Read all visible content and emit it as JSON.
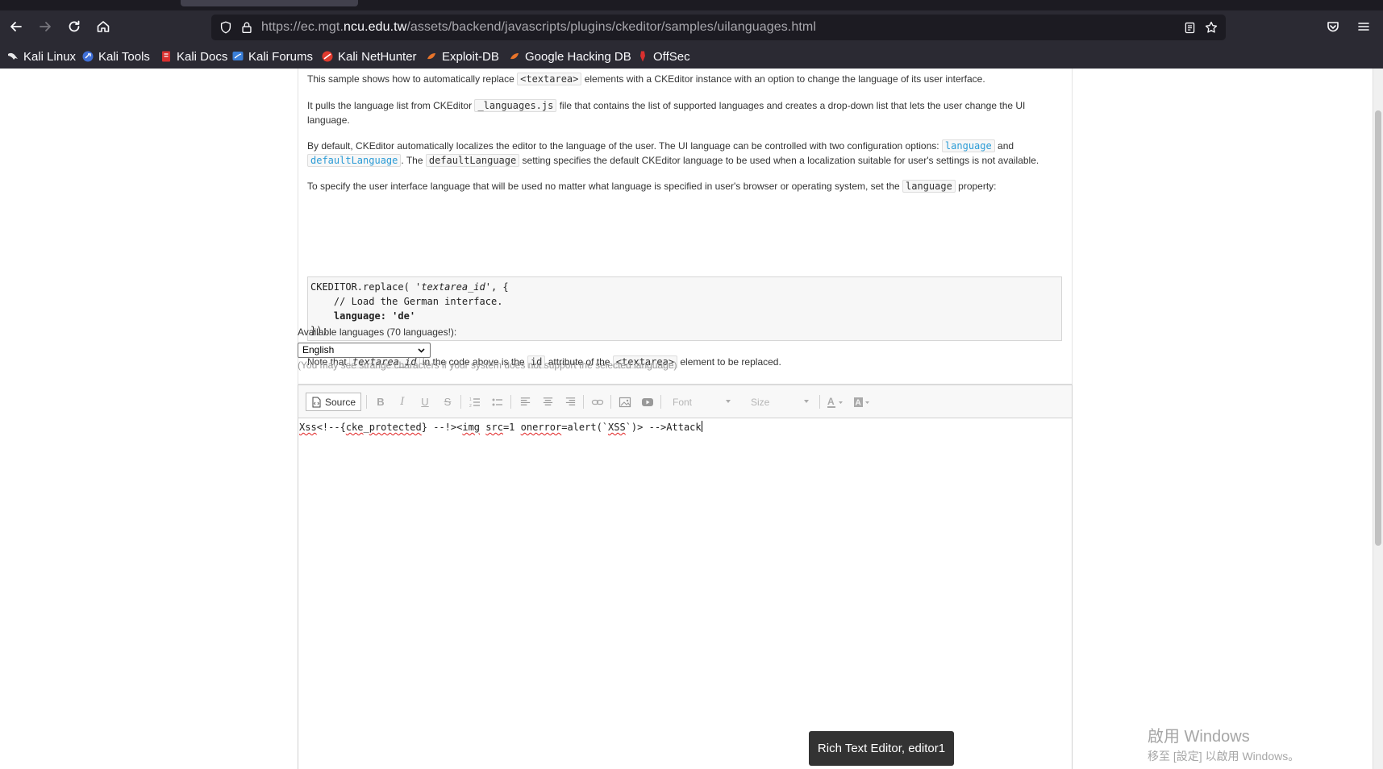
{
  "browser": {
    "url_prefix": "https://ec.mgt.",
    "url_domain": "ncu.edu.tw",
    "url_path": "/assets/backend/javascripts/plugins/ckeditor/samples/uilanguages.html",
    "bookmarks": [
      {
        "label": "Kali Linux",
        "icon": "kali-dragon-icon"
      },
      {
        "label": "Kali Tools",
        "icon": "kali-tools-icon"
      },
      {
        "label": "Kali Docs",
        "icon": "kali-docs-icon"
      },
      {
        "label": "Kali Forums",
        "icon": "kali-forums-icon"
      },
      {
        "label": "Kali NetHunter",
        "icon": "nethunter-icon"
      },
      {
        "label": "Exploit-DB",
        "icon": "exploit-db-icon"
      },
      {
        "label": "Google Hacking DB",
        "icon": "ghdb-icon"
      },
      {
        "label": "OffSec",
        "icon": "offsec-icon"
      }
    ]
  },
  "description": {
    "p1_before": "This sample shows how to automatically replace ",
    "p1_code": "<textarea>",
    "p1_after": " elements with a CKEditor instance with an option to change the language of its user interface.",
    "p2_before": "It pulls the language list from CKEditor ",
    "p2_code": "_languages.js",
    "p2_after": " file that contains the list of supported languages and creates a drop-down list that lets the user change the UI language.",
    "p3_before": "By default, CKEditor automatically localizes the editor to the language of the user. The UI language can be controlled with two configuration options: ",
    "p3_code1": "language",
    "p3_mid": " and ",
    "p3_code2": "defaultLanguage",
    "p3_mid2": ". The ",
    "p3_code3": "defaultLanguage",
    "p3_after": " setting specifies the default CKEditor language to be used when a localization suitable for user's settings is not available.",
    "p4_before": "To specify the user interface language that will be used no matter what language is specified in user's browser or operating system, set the ",
    "p4_code": "language",
    "p4_after": " property:",
    "code_l1a": "CKEDITOR.replace( ",
    "code_l1b": "'textarea_id'",
    "code_l1c": ", {",
    "code_l2": "    // Load the German interface.",
    "code_l3": "    language: 'de'",
    "code_l4": "});",
    "p5_before": "Note that ",
    "p5_code1": "textarea_id",
    "p5_mid": " in the code above is the ",
    "p5_code2": "id",
    "p5_mid2": " attribute of the ",
    "p5_code3": "<textarea>",
    "p5_after": " element to be replaced."
  },
  "languages": {
    "label": "Available languages (70 languages!):",
    "selected": "English",
    "note": "(You may see strange characters if your system does not support the selected language)"
  },
  "editor": {
    "source_label": "Source",
    "font_label": "Font",
    "size_label": "Size",
    "content_parts": [
      "Xss",
      "<!--{",
      "cke",
      "_",
      "protected",
      "} --!><",
      "img",
      " ",
      "src",
      "=1 ",
      "onerror",
      "=alert(`",
      "XSS",
      "`)> -->Attack"
    ],
    "tooltip": "Rich Text Editor, editor1"
  },
  "watermark": {
    "line1": "啟用 Windows",
    "line2": "移至 [設定] 以啟用 Windows。"
  }
}
